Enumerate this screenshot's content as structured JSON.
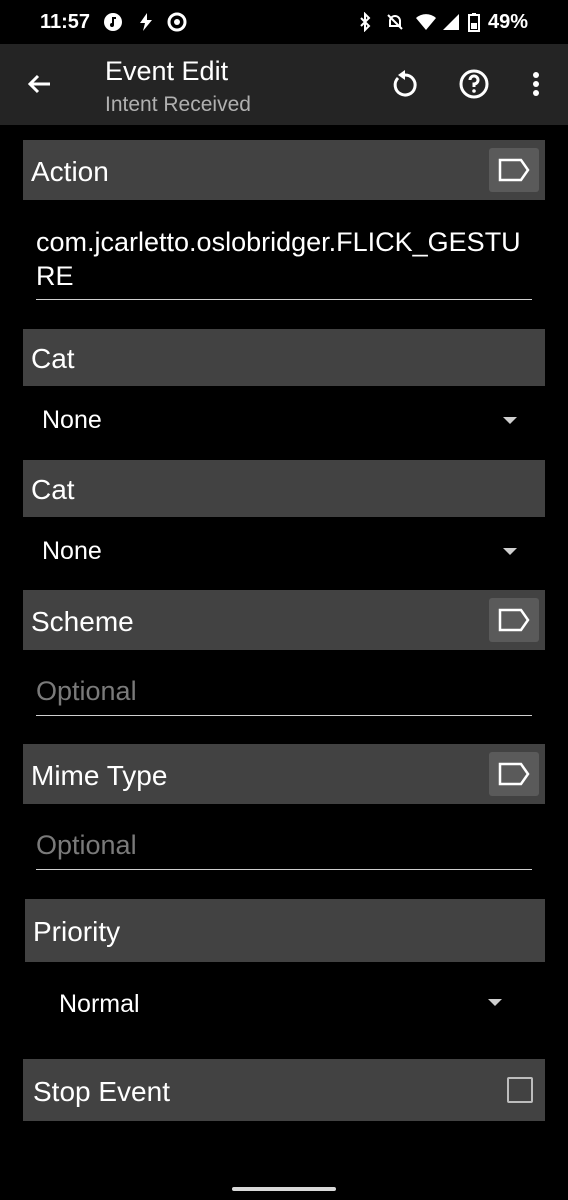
{
  "status_bar": {
    "time": "11:57",
    "battery": "49%"
  },
  "app_bar": {
    "title": "Event Edit",
    "subtitle": "Intent Received"
  },
  "sections": {
    "action": {
      "label": "Action",
      "value": "com.jcarletto.oslobridger.FLICK_GESTURE"
    },
    "cat1": {
      "label": "Cat",
      "value": "None"
    },
    "cat2": {
      "label": "Cat",
      "value": "None"
    },
    "scheme": {
      "label": "Scheme",
      "placeholder": "Optional"
    },
    "mime": {
      "label": "Mime Type",
      "placeholder": "Optional"
    },
    "priority": {
      "label": "Priority",
      "value": "Normal"
    },
    "stop_event": {
      "label": "Stop Event",
      "checked": false
    }
  },
  "icons": {
    "back": "arrow-left",
    "reset": "rotate-ccw",
    "help": "question-circle",
    "more": "more-vertical",
    "tag": "label-tag"
  }
}
